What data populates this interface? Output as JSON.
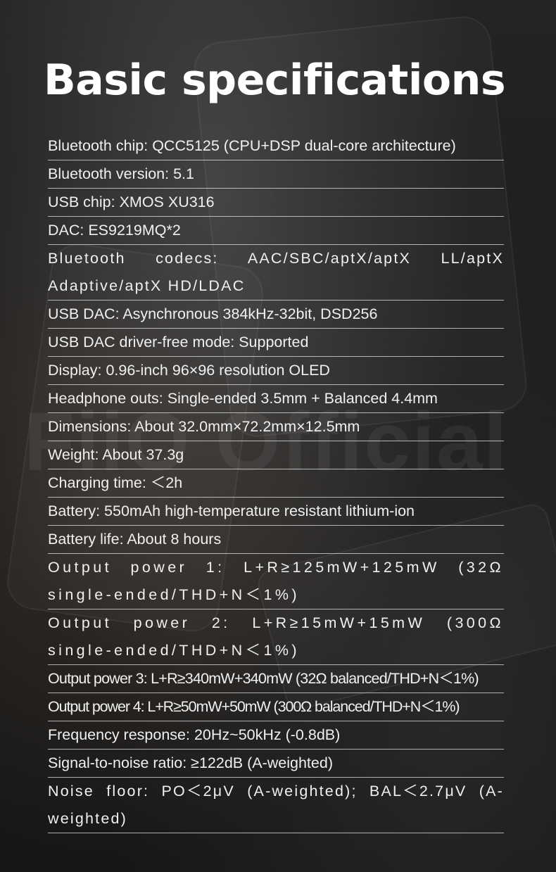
{
  "page": {
    "title": "Basic specifications",
    "watermark": "FiiO Official"
  },
  "specs": [
    "Bluetooth chip: QCC5125 (CPU+DSP dual-core architecture)",
    "Bluetooth version: 5.1",
    "USB chip: XMOS XU316",
    "DAC: ES9219MQ*2",
    "Bluetooth codecs: AAC/SBC/aptX/aptX LL/aptX Adaptive/aptX HD/LDAC",
    "USB DAC: Asynchronous 384kHz-32bit, DSD256",
    "USB DAC driver-free mode: Supported",
    "Display: 0.96-inch 96×96 resolution OLED",
    "Headphone outs: Single-ended 3.5mm + Balanced 4.4mm",
    "Dimensions: About 32.0mm×72.2mm×12.5mm",
    "Weight: About 37.3g",
    "Charging time: ＜2h",
    "Battery: 550mAh high-temperature resistant lithium-ion",
    "Battery life: About 8 hours",
    "Output power 1: L+R≥125mW+125mW (32Ω single-ended/THD+N＜1%)",
    "Output power 2: L+R≥15mW+15mW (300Ω single-ended/THD+N＜1%)",
    "Output power 3: L+R≥340mW+340mW (32Ω balanced/THD+N＜1%)",
    "Output power 4: L+R≥50mW+50mW (300Ω balanced/THD+N＜1%)",
    "Frequency response: 20Hz~50kHz (-0.8dB)",
    "Signal-to-noise ratio: ≥122dB (A-weighted)",
    "Noise floor: PO＜2μV (A-weighted); BAL＜2.7μV (A-weighted)"
  ]
}
